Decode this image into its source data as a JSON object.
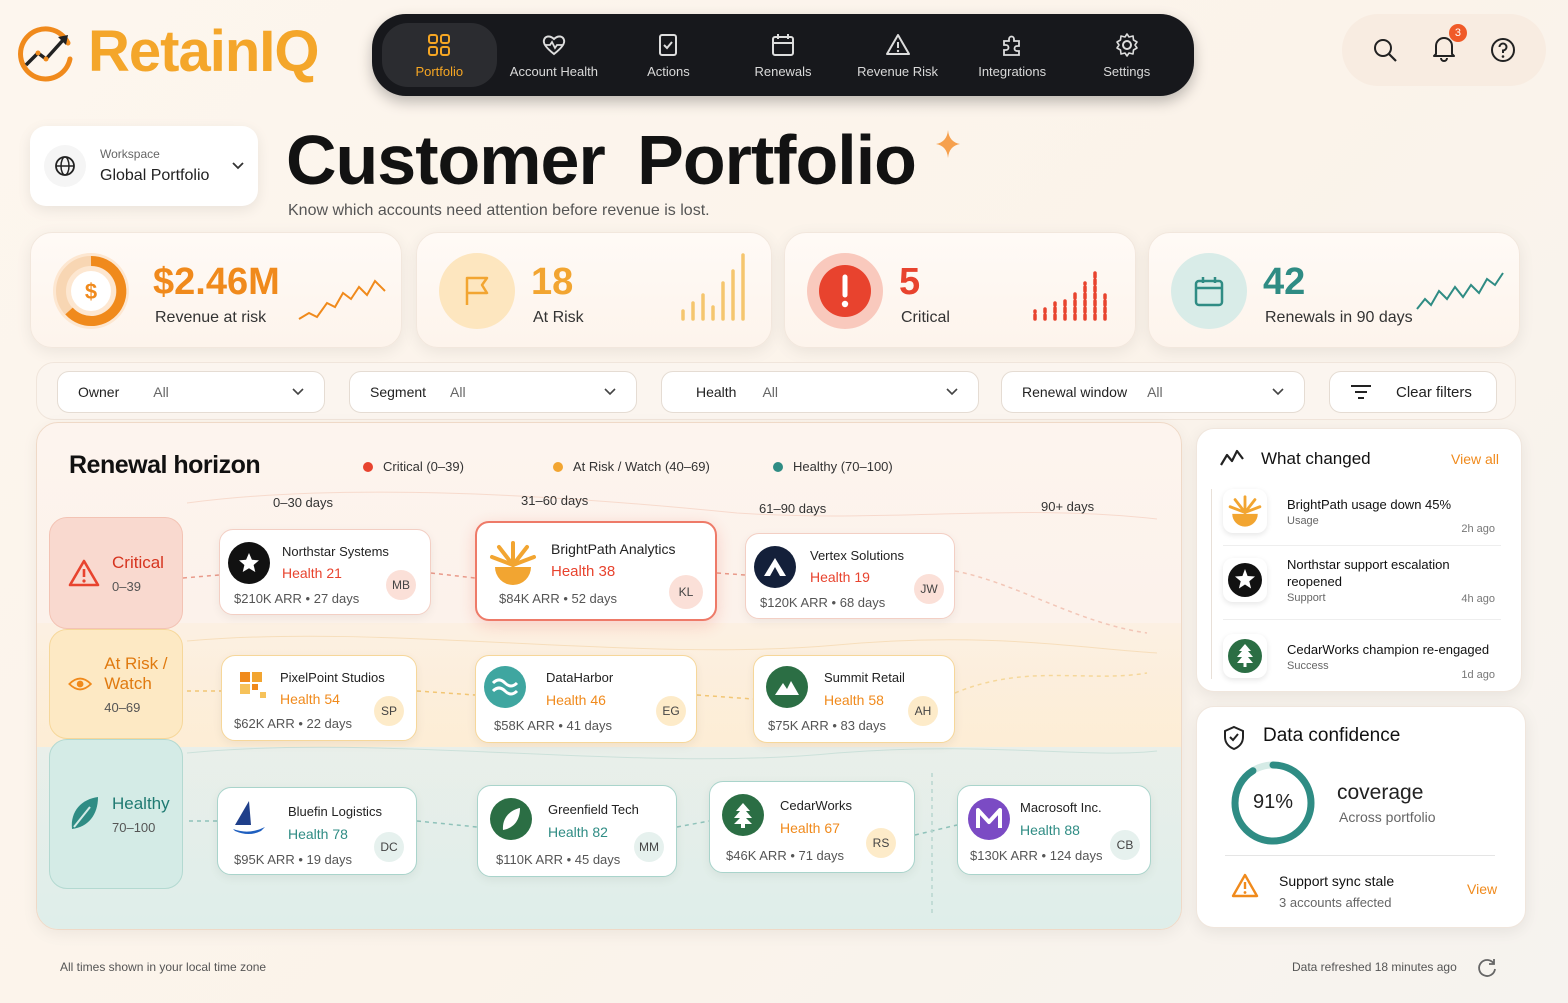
{
  "app": {
    "name": "RetainIQ"
  },
  "nav": {
    "items": [
      {
        "label": "Portfolio",
        "icon": "grid-icon"
      },
      {
        "label": "Account Health",
        "icon": "heartbeat-icon"
      },
      {
        "label": "Actions",
        "icon": "checklist-icon"
      },
      {
        "label": "Renewals",
        "icon": "calendar-icon"
      },
      {
        "label": "Revenue Risk",
        "icon": "warning-icon"
      },
      {
        "label": "Integrations",
        "icon": "puzzle-icon"
      },
      {
        "label": "Settings",
        "icon": "gear-icon"
      }
    ],
    "active": "Portfolio"
  },
  "header": {
    "notification_count": "3"
  },
  "workspace": {
    "label": "Workspace",
    "value": "Global Portfolio"
  },
  "page": {
    "title": "Customer  Portfolio",
    "subtitle": "Know which accounts need attention before revenue is lost."
  },
  "kpis": [
    {
      "value": "$2.46M",
      "label": "Revenue at risk",
      "color": "#f08a1c"
    },
    {
      "value": "18",
      "label": "At Risk",
      "color": "#f2a531"
    },
    {
      "value": "5",
      "label": "Critical",
      "color": "#e8432e"
    },
    {
      "value": "42",
      "label": "Renewals in 90 days",
      "color": "#2f8c84"
    }
  ],
  "filters": [
    {
      "key": "Owner",
      "value": "All"
    },
    {
      "key": "Segment",
      "value": "All"
    },
    {
      "key": "Health",
      "value": "All"
    },
    {
      "key": "Renewal window",
      "value": "All"
    },
    {
      "clear_label": "Clear filters"
    }
  ],
  "horizon": {
    "title": "Renewal horizon",
    "legend": [
      {
        "label": "Critical (0–39)",
        "color": "#e8432e"
      },
      {
        "label": "At Risk / Watch (40–69)",
        "color": "#f2a531"
      },
      {
        "label": "Healthy (70–100)",
        "color": "#2f8c84"
      }
    ],
    "columns": [
      "0–30 days",
      "31–60 days",
      "61–90 days",
      "90+ days"
    ],
    "rows": [
      {
        "name": "Critical",
        "range": "0–39"
      },
      {
        "name": "At Risk / Watch",
        "range": "40–69"
      },
      {
        "name": "Healthy",
        "range": "70–100"
      }
    ],
    "accounts": [
      {
        "name": "Northstar Systems",
        "health": "Health 21",
        "meta": "$210K ARR  •  27 days",
        "owner": "MB"
      },
      {
        "name": "BrightPath Analytics",
        "health": "Health 38",
        "meta": "$84K ARR  •  52 days",
        "owner": "KL"
      },
      {
        "name": "Vertex Solutions",
        "health": "Health 19",
        "meta": "$120K ARR  •  68 days",
        "owner": "JW"
      },
      {
        "name": "PixelPoint Studios",
        "health": "Health 54",
        "meta": "$62K ARR  •  22 days",
        "owner": "SP"
      },
      {
        "name": "DataHarbor",
        "health": "Health 46",
        "meta": "$58K ARR  •  41 days",
        "owner": "EG"
      },
      {
        "name": "Summit Retail",
        "health": "Health 58",
        "meta": "$75K ARR  •  83 days",
        "owner": "AH"
      },
      {
        "name": "Bluefin Logistics",
        "health": "Health 78",
        "meta": "$95K ARR  •  19 days",
        "owner": "DC"
      },
      {
        "name": "Greenfield Tech",
        "health": "Health 82",
        "meta": "$110K ARR  •  45 days",
        "owner": "MM"
      },
      {
        "name": "CedarWorks",
        "health": "Health 67",
        "meta": "$46K ARR  •  71 days",
        "owner": "RS"
      },
      {
        "name": "Macrosoft Inc.",
        "health": "Health 88",
        "meta": "$130K ARR  •  124 days",
        "owner": "CB"
      }
    ]
  },
  "changes": {
    "title": "What changed",
    "view_all": "View all",
    "items": [
      {
        "text": "BrightPath usage down 45%",
        "category": "Usage",
        "time": "2h ago"
      },
      {
        "text": "Northstar support escalation reopened",
        "category": "Support",
        "time": "4h ago"
      },
      {
        "text": "CedarWorks champion re-engaged",
        "category": "Success",
        "time": "1d ago"
      }
    ]
  },
  "confidence": {
    "title": "Data confidence",
    "percent": "91%",
    "percent_value": 0.91,
    "label": "coverage",
    "sublabel": "Across portfolio",
    "alert": {
      "title": "Support sync stale",
      "detail": "3 accounts affected",
      "action": "View"
    }
  },
  "footer": {
    "left": "All times shown in your local time zone",
    "right": "Data refreshed 18 minutes ago"
  }
}
